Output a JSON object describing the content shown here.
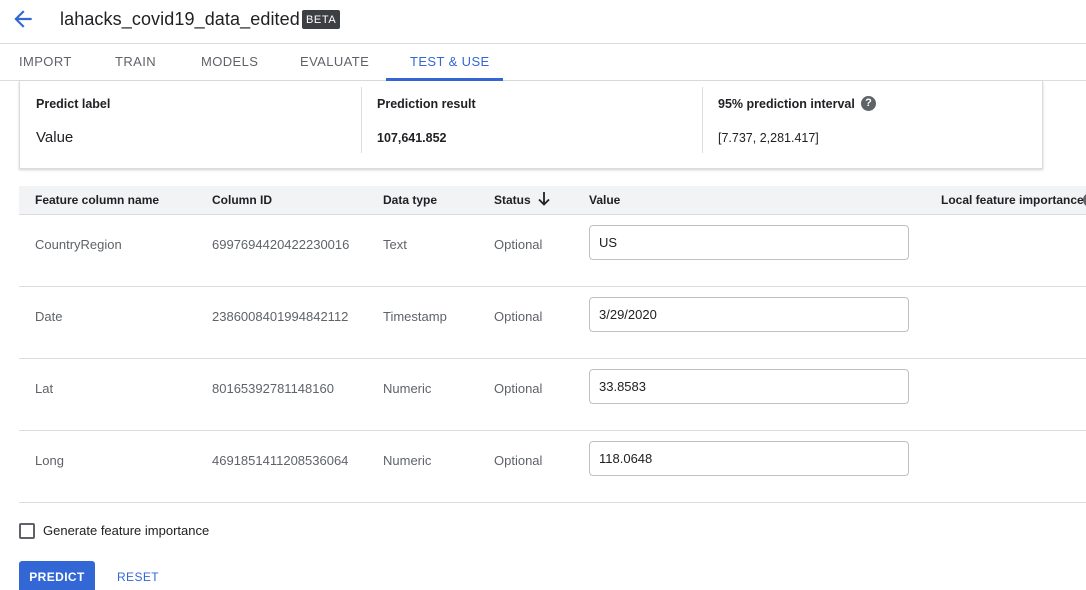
{
  "header": {
    "title": "lahacks_covid19_data_edited",
    "badge": "BETA"
  },
  "tabs": [
    {
      "label": "IMPORT",
      "active": false
    },
    {
      "label": "TRAIN",
      "active": false
    },
    {
      "label": "MODELS",
      "active": false
    },
    {
      "label": "EVALUATE",
      "active": false
    },
    {
      "label": "TEST & USE",
      "active": true
    }
  ],
  "result": {
    "predict_label_header": "Predict label",
    "predict_label_value": "Value",
    "prediction_result_header": "Prediction result",
    "prediction_result_value": "107,641.852",
    "interval_header": "95% prediction interval",
    "interval_value": "[7.737, 2,281.417]",
    "help_icon": "?"
  },
  "table": {
    "columns": {
      "name": "Feature column name",
      "id": "Column ID",
      "type": "Data type",
      "status": "Status",
      "value": "Value",
      "importance": "Local feature importance"
    },
    "rows": [
      {
        "name": "CountryRegion",
        "id": "6997694420422230016",
        "type": "Text",
        "status": "Optional",
        "value": "US"
      },
      {
        "name": "Date",
        "id": "2386008401994842112",
        "type": "Timestamp",
        "status": "Optional",
        "value": "3/29/2020"
      },
      {
        "name": "Lat",
        "id": "80165392781148160",
        "type": "Numeric",
        "status": "Optional",
        "value": "33.8583"
      },
      {
        "name": "Long",
        "id": "4691851411208536064",
        "type": "Numeric",
        "status": "Optional",
        "value": "118.0648"
      }
    ]
  },
  "feature_importance": {
    "label": "Generate feature importance",
    "checked": false
  },
  "actions": {
    "predict": "PREDICT",
    "reset": "RESET"
  },
  "colors": {
    "accent": "#3367d6",
    "badge_bg": "#3c4043",
    "header_row_bg": "#f1f3f4"
  },
  "icons": {
    "back": "arrow-back-icon",
    "sort": "arrow-downward-icon",
    "help": "help-circle-icon"
  }
}
